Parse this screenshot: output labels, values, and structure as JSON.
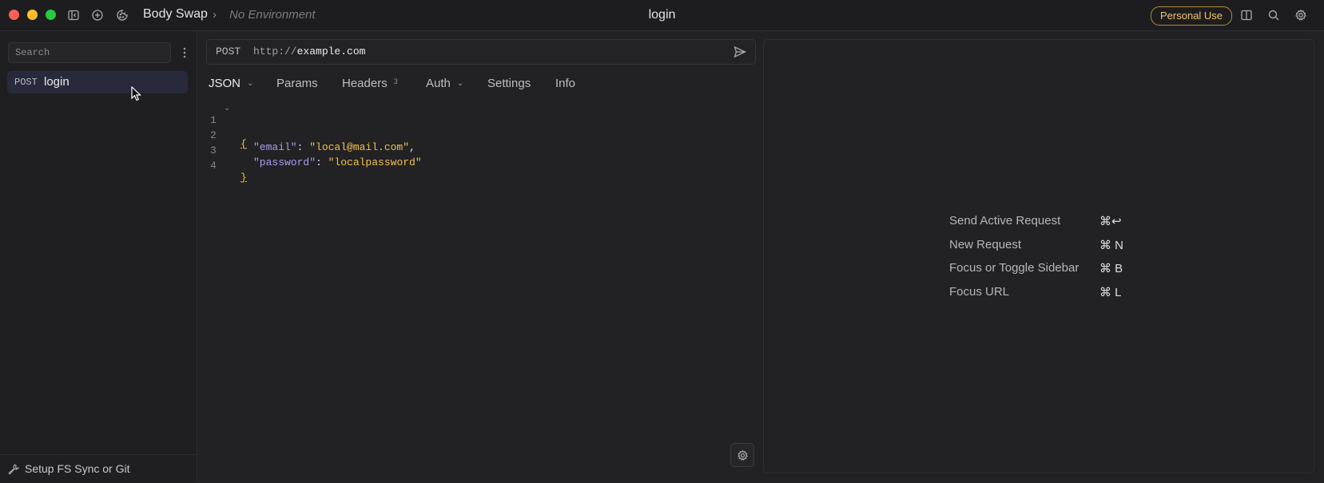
{
  "titlebar": {
    "workspace": "Body Swap",
    "environment": "No Environment",
    "title": "login",
    "badge": "Personal Use",
    "traffic_colors": [
      "#ff5f57",
      "#febc2e",
      "#28c840"
    ],
    "icons": [
      "sidebar-toggle-icon",
      "add-circle-icon",
      "cookie-icon",
      "split-pane-icon",
      "search-icon",
      "gear-icon"
    ]
  },
  "sidebar": {
    "search_placeholder": "Search",
    "requests": [
      {
        "method": "POST",
        "name": "login"
      }
    ],
    "footer_label": "Setup FS Sync or Git"
  },
  "request": {
    "method": "POST",
    "url_protocol": "http://",
    "url_host": "example.com",
    "tabs": [
      {
        "label": "JSON"
      },
      {
        "label": "Params"
      },
      {
        "label": "Headers",
        "count": "3"
      },
      {
        "label": "Auth"
      },
      {
        "label": "Settings"
      },
      {
        "label": "Info"
      }
    ],
    "body_lines": [
      {
        "num": "1",
        "open": "{"
      },
      {
        "num": "2",
        "key": "\"email\"",
        "sep": ": ",
        "value": "\"local@mail.com\"",
        "trail": ","
      },
      {
        "num": "3",
        "key": "\"password\"",
        "sep": ": ",
        "value": "\"localpassword\"",
        "trail": ""
      },
      {
        "num": "4",
        "close": "}"
      }
    ]
  },
  "shortcuts": [
    {
      "label": "Send Active Request",
      "keys": "⌘↩"
    },
    {
      "label": "New Request",
      "keys": "⌘ N"
    },
    {
      "label": "Focus or Toggle Sidebar",
      "keys": "⌘ B"
    },
    {
      "label": "Focus URL",
      "keys": "⌘ L"
    }
  ],
  "colors": {
    "accent_badge": "#f0c46b",
    "json_key": "#a99cf0",
    "json_string": "#f2c14e",
    "selected_item_bg": "#282a3b"
  }
}
